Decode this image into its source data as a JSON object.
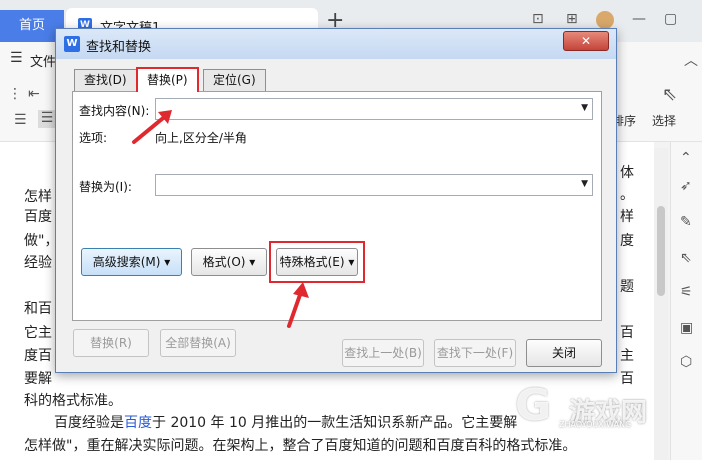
{
  "app": {
    "home_tab": "首页",
    "doc_tab": "文字文稿1",
    "doc_icon": "W",
    "new_tab": "+",
    "file_menu": "文件",
    "ribbon": {
      "sort_label": "排序",
      "select_label": "选择"
    }
  },
  "document": {
    "lines": [
      "怎样",
      "百度",
      "做\"，",
      "经验",
      "和百",
      "它主",
      "度百",
      "要解",
      "科的格式标准。"
    ],
    "right_fragments": [
      "体",
      "。",
      "样",
      "度",
      "题",
      "百",
      "主",
      "百"
    ],
    "paragraph": {
      "prefix": "百度经验是",
      "link": "百度",
      "suffix": "于 2010 年 10 月推出的一款生活知识系新产品。它主要解",
      "line2": "怎样做\"，重在解决实际问题。在架构上，整合了百度知道的问题和百度百科的格式标准。"
    }
  },
  "watermark": {
    "logo": "G",
    "text": "游戏网",
    "small": "ZHAOYOUXIWANG"
  },
  "dialog": {
    "title": "查找和替换",
    "title_icon": "W",
    "tabs": [
      {
        "label": "查找(D)"
      },
      {
        "label": "替换(P)"
      },
      {
        "label": "定位(G)"
      }
    ],
    "find_label": "查找内容(N):",
    "find_value": "",
    "options_label": "选项:",
    "options_value": "向上,区分全/半角",
    "replace_label": "替换为(I):",
    "replace_value": "",
    "buttons": {
      "advanced": "高级搜索(M)",
      "format": "格式(O)",
      "special": "特殊格式(E)",
      "replace": "替换(R)",
      "replace_all": "全部替换(A)",
      "find_prev": "查找上一处(B)",
      "find_next": "查找下一处(F)",
      "close": "关闭"
    }
  },
  "colors": {
    "accent": "#4a7de8",
    "highlight": "#e0292f"
  }
}
